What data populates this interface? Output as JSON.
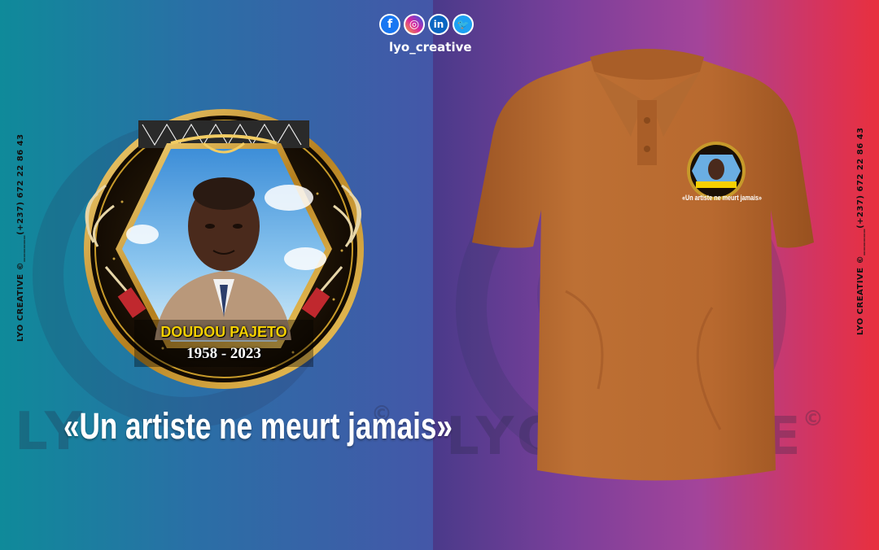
{
  "social": {
    "icons": [
      {
        "name": "facebook-icon",
        "glyph": "f",
        "color": "#1877f2"
      },
      {
        "name": "instagram-icon",
        "glyph": "◎",
        "color": "#d6249f"
      },
      {
        "name": "linkedin-icon",
        "glyph": "in",
        "color": "#0a66c2"
      },
      {
        "name": "twitter-icon",
        "glyph": "🐦",
        "color": "#1da1f2"
      }
    ],
    "handle": "lyo_creative"
  },
  "watermark": {
    "left": "LY",
    "right_a": "LYO",
    "right_b": "E",
    "copyright": "©"
  },
  "side_text": {
    "left": "LYO CREATIVE ©______(+237) 672 22 86 43",
    "right": "LYO CREATIVE ©______(+237) 672 22 86 43"
  },
  "medal": {
    "name": "DOUDOU PAJETO",
    "years": "1958 - 2023"
  },
  "quote": "«Un artiste ne meurt jamais»",
  "shirt": {
    "quote": "«Un artiste ne meurt jamais»",
    "color": "#b8692f"
  },
  "colors": {
    "accent_yellow": "#f5d000",
    "gold": "#c79a2a"
  }
}
